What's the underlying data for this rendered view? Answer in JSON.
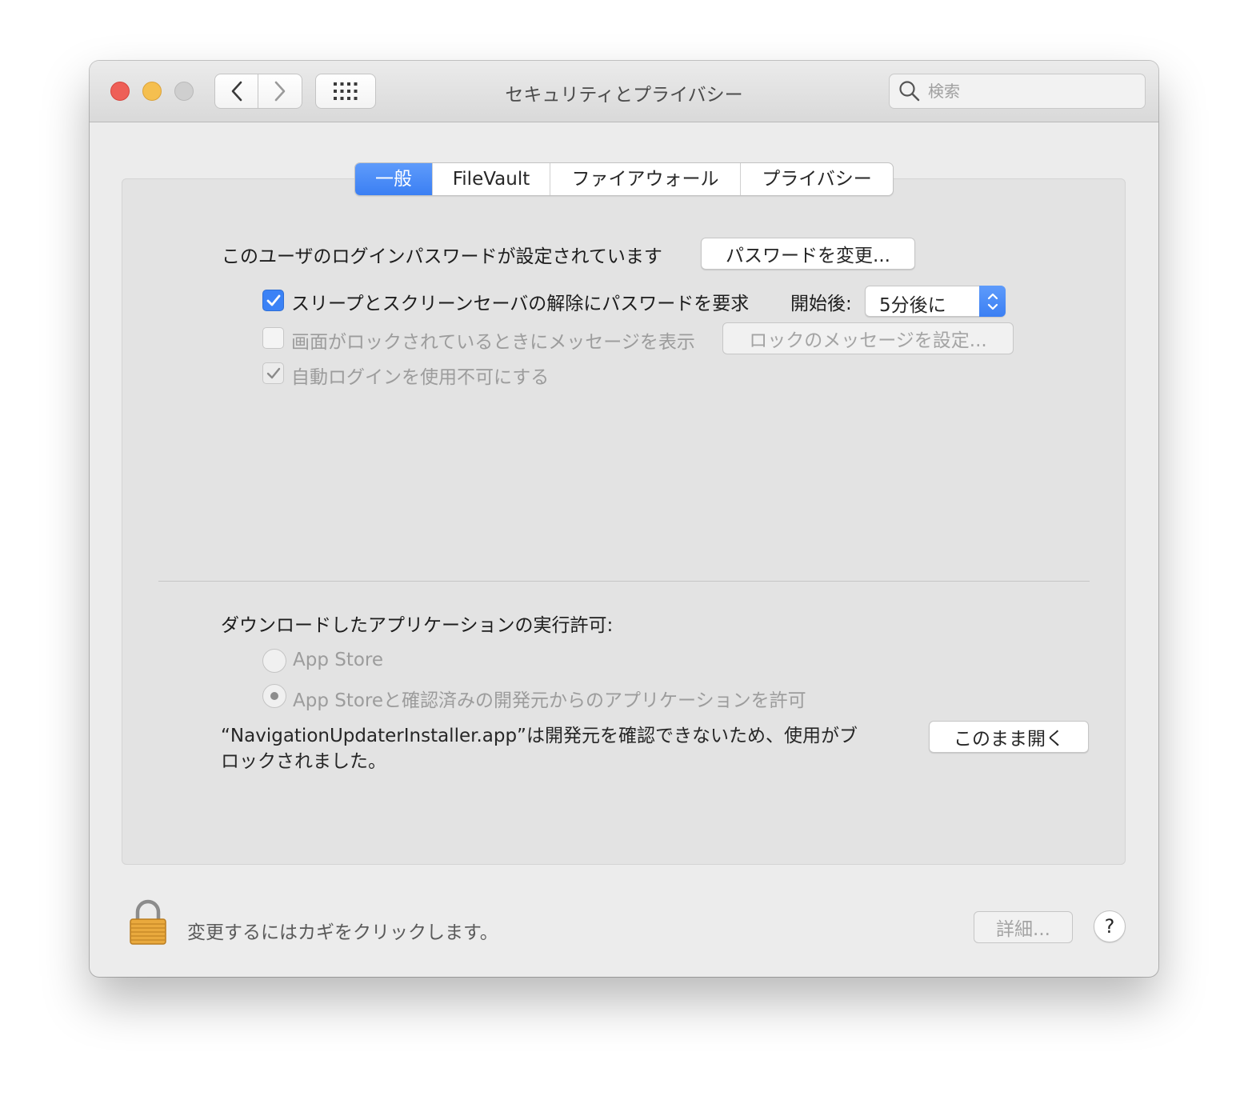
{
  "window": {
    "title": "セキュリティとプライバシー",
    "search_placeholder": "検索"
  },
  "tabs": [
    {
      "label": "一般",
      "active": true
    },
    {
      "label": "FileVault",
      "active": false
    },
    {
      "label": "ファイアウォール",
      "active": false
    },
    {
      "label": "プライバシー",
      "active": false
    }
  ],
  "general": {
    "login_password_text": "このユーザのログインパスワードが設定されています",
    "change_password_label": "パスワードを変更...",
    "require_password": {
      "label": "スリープとスクリーンセーバの解除にパスワードを要求",
      "checked": true,
      "after_label": "開始後:",
      "delay_value": "5分後に"
    },
    "lock_message": {
      "label": "画面がロックされているときにメッセージを表示",
      "checked": false,
      "button_label": "ロックのメッセージを設定..."
    },
    "disable_auto_login": {
      "label": "自動ログインを使用不可にする",
      "checked": true
    },
    "downloads": {
      "heading": "ダウンロードしたアプリケーションの実行許可:",
      "options": [
        {
          "label": "App Store",
          "selected": false
        },
        {
          "label": "App Storeと確認済みの開発元からのアプリケーションを許可",
          "selected": true
        }
      ],
      "blocked_line1": "“NavigationUpdaterInstaller.app”は開発元を確認できないため、使用がブ",
      "blocked_line2": "ロックされました。",
      "open_anyway_label": "このまま開く"
    }
  },
  "footer": {
    "lock_text": "変更するにはカギをクリックします。",
    "advanced_label": "詳細...",
    "help_label": "?"
  },
  "colors": {
    "accent": "#3b82f6",
    "close": "#ee5f57",
    "minimize": "#f5bf4f",
    "zoom_disabled": "#cfcfcf"
  }
}
